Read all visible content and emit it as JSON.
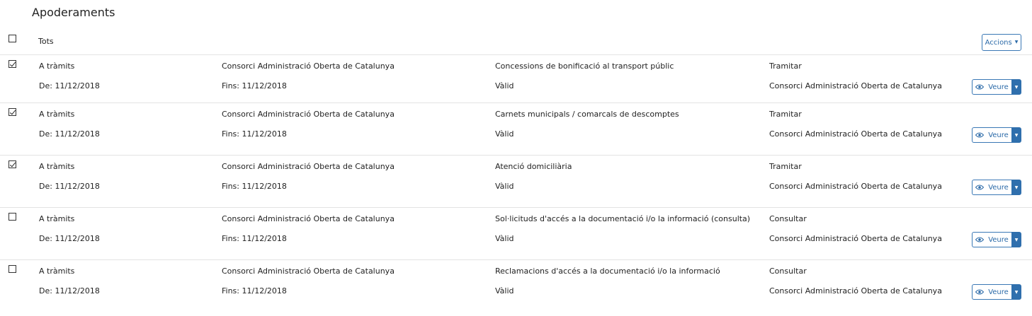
{
  "page": {
    "title": "Apoderaments"
  },
  "header": {
    "select_all_label": "Tots",
    "actions_label": "Accions",
    "actions_caret": "▼"
  },
  "view": {
    "label": "Veure",
    "caret": "▼"
  },
  "rows": [
    {
      "checked": true,
      "type": "A tràmits",
      "date_from": "De: 11/12/2018",
      "entity": "Consorci Administració Oberta de Catalunya",
      "date_to": "Fins: 11/12/2018",
      "procedure": "Concessions de bonificació al transport públic",
      "status": "Vàlid",
      "permission": "Tramitar",
      "grantor": "Consorci Administració Oberta de Catalunya"
    },
    {
      "checked": true,
      "type": "A tràmits",
      "date_from": "De: 11/12/2018",
      "entity": "Consorci Administració Oberta de Catalunya",
      "date_to": "Fins: 11/12/2018",
      "procedure": "Carnets municipals / comarcals de descomptes",
      "status": "Vàlid",
      "permission": "Tramitar",
      "grantor": "Consorci Administració Oberta de Catalunya"
    },
    {
      "checked": true,
      "type": "A tràmits",
      "date_from": "De: 11/12/2018",
      "entity": "Consorci Administració Oberta de Catalunya",
      "date_to": "Fins: 11/12/2018",
      "procedure": "Atenció domiciliària",
      "status": "Vàlid",
      "permission": "Tramitar",
      "grantor": "Consorci Administració Oberta de Catalunya"
    },
    {
      "checked": false,
      "type": "A tràmits",
      "date_from": "De: 11/12/2018",
      "entity": "Consorci Administració Oberta de Catalunya",
      "date_to": "Fins: 11/12/2018",
      "procedure": "Sol·licituds d'accés a la documentació i/o la informació (consulta)",
      "status": "Vàlid",
      "permission": "Consultar",
      "grantor": "Consorci Administració Oberta de Catalunya"
    },
    {
      "checked": false,
      "type": "A tràmits",
      "date_from": "De: 11/12/2018",
      "entity": "Consorci Administració Oberta de Catalunya",
      "date_to": "Fins: 11/12/2018",
      "procedure": "Reclamacions d'accés a la documentació i/o la informació",
      "status": "Vàlid",
      "permission": "Consultar",
      "grantor": "Consorci Administració Oberta de Catalunya"
    }
  ],
  "colors": {
    "accent": "#2f6fad",
    "divider": "#e3e3e3"
  }
}
